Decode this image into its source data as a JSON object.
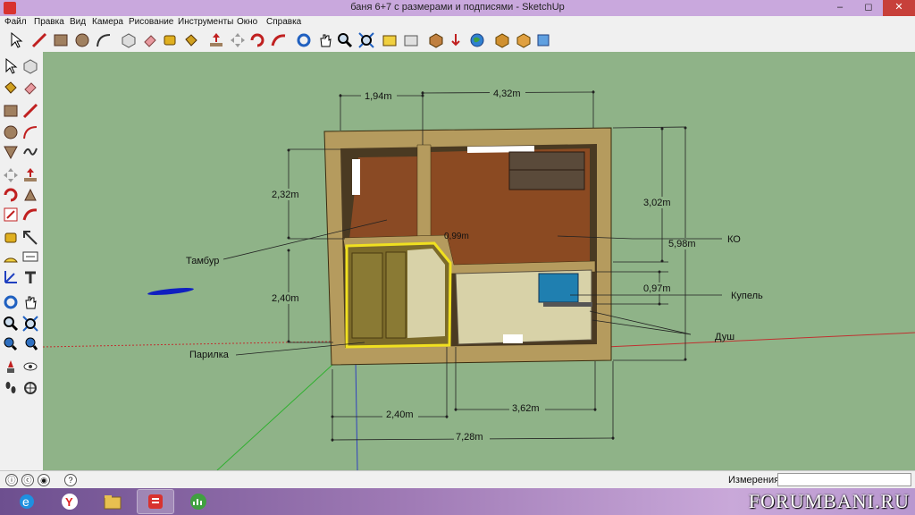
{
  "window": {
    "title": "баня 6+7 с размерами и подписями - SketchUp"
  },
  "menu": [
    "Файл",
    "Правка",
    "Вид",
    "Камера",
    "Рисование",
    "Инструменты",
    "Окно",
    "Справка"
  ],
  "window_controls": {
    "minimize": "–",
    "maximize": "◻",
    "close": "✕"
  },
  "dimensions": {
    "top_left": "1,94m",
    "top_right": "4,32m",
    "left_upper": "2,32m",
    "left_lower": "2,40m",
    "right_upper": "3,02m",
    "right_total": "5,98m",
    "right_small": "0,97m",
    "bottom_left": "2,40m",
    "bottom_right": "3,62m",
    "bottom_total": "7,28m",
    "inner_diag": "0,99m"
  },
  "room_labels": {
    "tambur": "Тамбур",
    "parilka": "Парилка",
    "ko": "КО",
    "kupel": "Купель",
    "dush": "Душ"
  },
  "status": {
    "measurements_label": "Измерения",
    "measurements_value": "",
    "help_icon": "?"
  },
  "watermark": "FORUMBANI.RU",
  "colors": {
    "titlebar": "#c9a8dd",
    "viewport": "#8fb388",
    "wall": "#b59b5e",
    "floor_wood": "#8a4a24",
    "tile": "#d8d2a8",
    "water": "#1f7fb0",
    "highlight": "#f0e020"
  }
}
